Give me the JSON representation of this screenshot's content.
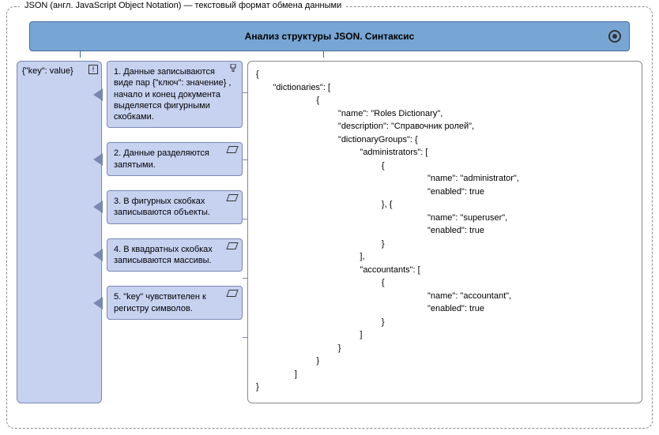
{
  "frame": {
    "title": "JSON (англ. JavaScript Object Notation) — текстовый формат обмена данными"
  },
  "header": {
    "title": "Анализ структуры JSON. Синтаксис"
  },
  "keyBox": {
    "label": "{\"key\": value}",
    "badge": "!"
  },
  "notes": [
    "1. Данные записываются виде пар {\"ключ\": значение} , начало и конец документа выделяется фигурными скобками.",
    "2. Данные разделяются запятыми.",
    "3. В фигурных скобках записываются объекты.",
    "4. В квадратных скобках записываются массивы.",
    "5. \"key\" чувствителен к регистру символов."
  ],
  "code": "{\n       \"dictionaries\": [\n                         {\n                                  \"name\": \"Roles Dictionary\",\n                                  \"description\": \"Справочник ролей\",\n                                  \"dictionaryGroups\": {\n                                           \"administrators\": [\n                                                    {\n                                                                       \"name\": \"administrator\",\n                                                                       \"enabled\": true\n                                                    }, {\n                                                                       \"name\": \"superuser\",\n                                                                       \"enabled\": true\n                                                    }\n                                           ],\n                                           \"accountants\": [\n                                                    {\n                                                                       \"name\": \"accountant\",\n                                                                       \"enabled\": true\n                                                    }\n                                           ]\n                                  }\n                         }\n                ]\n}"
}
